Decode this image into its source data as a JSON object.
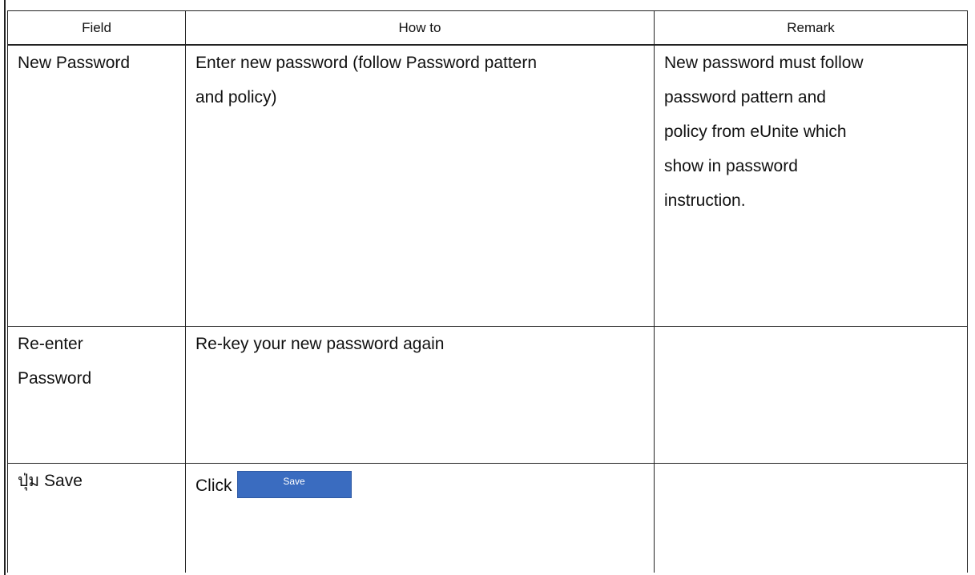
{
  "table": {
    "headers": {
      "field": "Field",
      "how_to": "How to",
      "remark": "Remark"
    },
    "rows": [
      {
        "field": "New Password",
        "how_to_lines": [
          "Enter new password (follow Password pattern",
          "and policy)"
        ],
        "remark_lines": [
          "New password must follow",
          "password pattern and",
          "policy from eUnite which",
          "show in password",
          "instruction."
        ]
      },
      {
        "field_lines": [
          "Re-enter",
          "Password"
        ],
        "how_to": "Re-key your new password again",
        "remark": ""
      },
      {
        "field": "ปุ่ม Save",
        "how_to_prefix": "Click",
        "button_label": "Save",
        "remark": ""
      }
    ]
  },
  "colors": {
    "border": "#222222",
    "save_button": "#3a6cc0"
  }
}
